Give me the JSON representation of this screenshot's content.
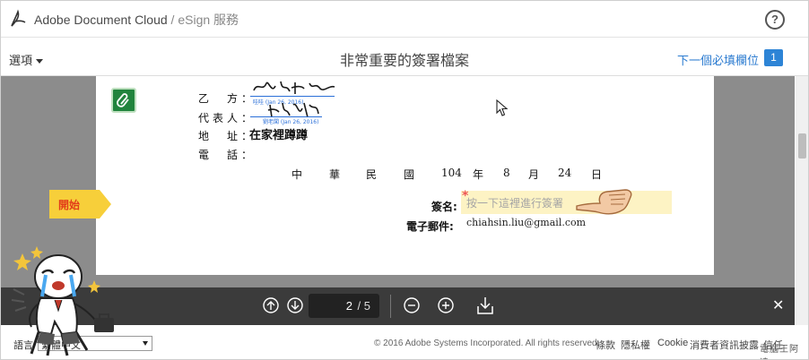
{
  "header": {
    "brand": "Adobe Document Cloud",
    "separator": "/",
    "service": "eSign 服務",
    "help_icon": "?"
  },
  "toolbar": {
    "options_label": "選項",
    "doc_title": "非常重要的簽署檔案",
    "next_field_label": "下一個必填欄位",
    "next_field_count": "1"
  },
  "document": {
    "party_b_label": "乙　方：",
    "rep_label": "代表人：",
    "addr_label": "地　址：",
    "phone_label": "電　話：",
    "sig_stamp_1": "哇哇 (Jan 26, 2016)",
    "sig_stamp_2": "劉老闆 (Jan 26, 2016)",
    "address_value": "在家裡蹲蹲",
    "date_parts": [
      "中",
      "華",
      "民",
      "國",
      "104",
      "年",
      "8",
      "月",
      "24",
      "日"
    ],
    "sign_label": "簽名:",
    "required_star": "*",
    "sign_placeholder": "按一下這裡進行簽署",
    "email_label": "電子郵件:",
    "email_value": "chiahsin.liu@gmail.com",
    "start_label": "開始"
  },
  "pager": {
    "current_page": "2",
    "total_pages": "/ 5",
    "close_symbol": "✕"
  },
  "footer": {
    "language_label": "語言",
    "language_value": "繁體中文",
    "copyright": "© 2016 Adobe Systems Incorporated. All rights reserved.",
    "links": [
      "條款",
      "隱私權",
      "Cookie",
      "消費者資訊披露",
      "信任"
    ]
  },
  "watermark": "電腦王阿達",
  "colors": {
    "link": "#2b7bd0",
    "badge": "#2d84d6",
    "doc_background": "#8c8c8c",
    "pager_bar": "#3b3b3b",
    "sign_field": "#fdf3c4",
    "start_tab": "#f7cf3a"
  }
}
